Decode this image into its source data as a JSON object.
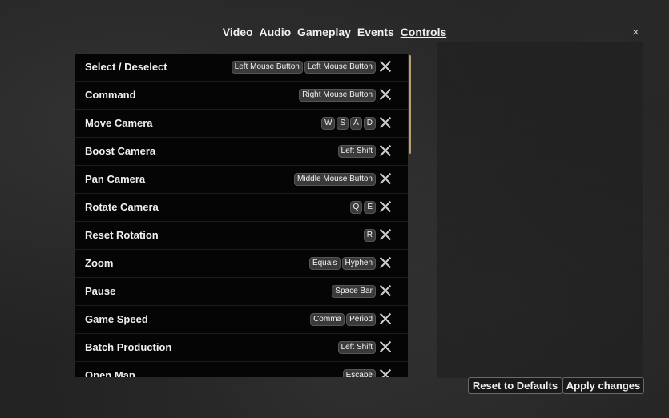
{
  "tabs": [
    "Video",
    "Audio",
    "Gameplay",
    "Events",
    "Controls"
  ],
  "active_tab": "Controls",
  "close_label": "×",
  "bindings": [
    {
      "label": "Select / Deselect",
      "keys": [
        "Left Mouse Button",
        "Left Mouse Button"
      ]
    },
    {
      "label": "Command",
      "keys": [
        "Right Mouse Button"
      ]
    },
    {
      "label": "Move Camera",
      "keys": [
        "W",
        "S",
        "A",
        "D"
      ]
    },
    {
      "label": "Boost Camera",
      "keys": [
        "Left Shift"
      ]
    },
    {
      "label": "Pan Camera",
      "keys": [
        "Middle Mouse Button"
      ]
    },
    {
      "label": "Rotate Camera",
      "keys": [
        "Q",
        "E"
      ]
    },
    {
      "label": "Reset Rotation",
      "keys": [
        "R"
      ]
    },
    {
      "label": "Zoom",
      "keys": [
        "Equals",
        "Hyphen"
      ]
    },
    {
      "label": "Pause",
      "keys": [
        "Space Bar"
      ]
    },
    {
      "label": "Game Speed",
      "keys": [
        "Comma",
        "Period"
      ]
    },
    {
      "label": "Batch Production",
      "keys": [
        "Left Shift"
      ]
    },
    {
      "label": "Open Map",
      "keys": [
        "Escape"
      ]
    }
  ],
  "buttons": {
    "reset": "Reset to Defaults",
    "apply": "Apply changes"
  },
  "colors": {
    "scroll_thumb": "#b8a16e",
    "list_bg": "#050505"
  }
}
